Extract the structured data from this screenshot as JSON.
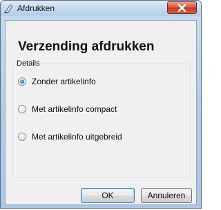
{
  "window": {
    "title": "Afdrukken",
    "app_icon": "printer-edit-icon",
    "close_icon": "close-icon"
  },
  "dialog": {
    "heading": "Verzending afdrukken",
    "group_label": "Details",
    "options": [
      {
        "label": "Zonder artikelinfo",
        "checked": true
      },
      {
        "label": "Met artikelinfo compact",
        "checked": false
      },
      {
        "label": "Met artikelinfo uitgebreid",
        "checked": false
      }
    ],
    "ok_label": "OK",
    "cancel_label": "Annuleren"
  },
  "colors": {
    "accent": "#2a7fc9",
    "close_button": "#c13e27"
  }
}
